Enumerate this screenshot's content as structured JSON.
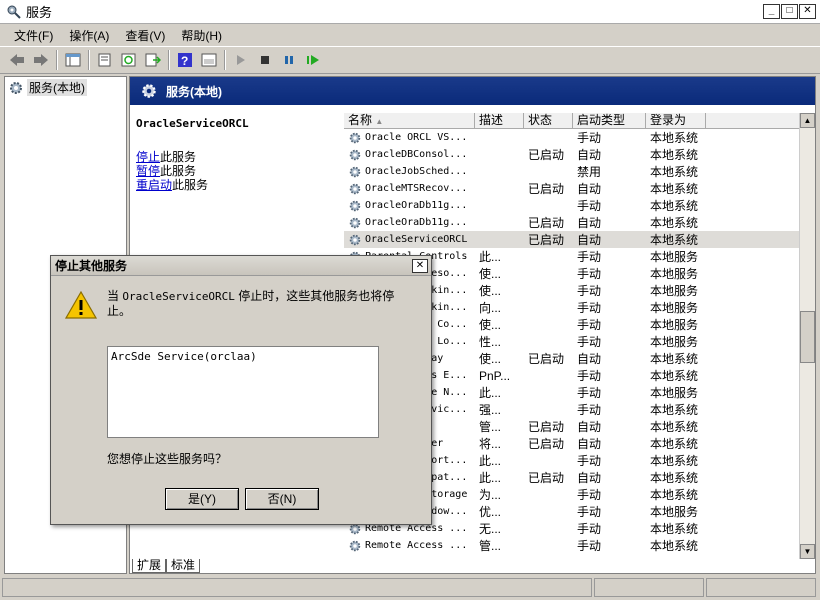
{
  "window": {
    "title": "服务"
  },
  "menu": [
    "文件(F)",
    "操作(A)",
    "查看(V)",
    "帮助(H)"
  ],
  "tree": {
    "item": "服务(本地)"
  },
  "pane": {
    "header": "服务(本地)",
    "selected_service": "OracleServiceORCL",
    "actions": [
      {
        "link": "停止",
        "rest": "此服务"
      },
      {
        "link": "暂停",
        "rest": "此服务"
      },
      {
        "link": "重启动",
        "rest": "此服务"
      }
    ]
  },
  "table": {
    "columns": [
      "名称",
      "描述",
      "状态",
      "启动类型",
      "登录为"
    ],
    "rows": [
      [
        "Oracle ORCL VS...",
        "",
        "",
        "手动",
        "本地系统"
      ],
      [
        "OracleDBConsol...",
        "",
        "已启动",
        "自动",
        "本地系统"
      ],
      [
        "OracleJobSched...",
        "",
        "",
        "禁用",
        "本地系统"
      ],
      [
        "OracleMTSRecov...",
        "",
        "已启动",
        "自动",
        "本地系统"
      ],
      [
        "OracleOraDb11g...",
        "",
        "",
        "手动",
        "本地系统"
      ],
      [
        "OracleOraDb11g...",
        "",
        "已启动",
        "自动",
        "本地系统"
      ],
      [
        "OracleServiceORCL",
        "",
        "已启动",
        "自动",
        "本地系统"
      ],
      [
        "Parental Controls",
        "此...",
        "",
        "手动",
        "本地服务"
      ],
      [
        "Peer Name Reso...",
        "使...",
        "",
        "手动",
        "本地服务"
      ],
      [
        "Peer Networkin...",
        "使...",
        "",
        "手动",
        "本地服务"
      ],
      [
        "Peer Networkin...",
        "向...",
        "",
        "手动",
        "本地服务"
      ],
      [
        "Performance Co...",
        "使...",
        "",
        "手动",
        "本地服务"
      ],
      [
        "Performance Lo...",
        "性...",
        "",
        "手动",
        "本地服务"
      ],
      [
        "Plug and Play",
        "使...",
        "已启动",
        "自动",
        "本地系统"
      ],
      [
        "PnP-X IP Bus E...",
        "PnP...",
        "",
        "手动",
        "本地系统"
      ],
      [
        "PNRP Machine N...",
        "此...",
        "",
        "手动",
        "本地服务"
      ],
      [
        "Portable Devic...",
        "强...",
        "",
        "手动",
        "本地系统"
      ],
      [
        "Power",
        "管...",
        "已启动",
        "自动",
        "本地系统"
      ],
      [
        "Print Spooler",
        "将...",
        "已启动",
        "自动",
        "本地系统"
      ],
      [
        "Problem Report...",
        "此...",
        "",
        "手动",
        "本地系统"
      ],
      [
        "Program Compat...",
        "此...",
        "已启动",
        "自动",
        "本地系统"
      ],
      [
        "Protected Storage",
        "为...",
        "",
        "手动",
        "本地系统"
      ],
      [
        "Quality Window...",
        "优...",
        "",
        "手动",
        "本地服务"
      ],
      [
        "Remote Access ...",
        "无...",
        "",
        "手动",
        "本地系统"
      ],
      [
        "Remote Access ...",
        "管...",
        "",
        "手动",
        "本地系统"
      ]
    ],
    "selected_index": 6
  },
  "tabs": [
    "扩展",
    "标准"
  ],
  "dialog": {
    "title": "停止其他服务",
    "msg_prefix": "当 ",
    "msg_service": "OracleServiceORCL",
    "msg_suffix": " 停止时，这些其他服务也将停止。",
    "dependents": [
      "ArcSde Service(orclaa)"
    ],
    "question": "您想停止这些服务吗？",
    "yes": "是(Y)",
    "no": "否(N)"
  }
}
